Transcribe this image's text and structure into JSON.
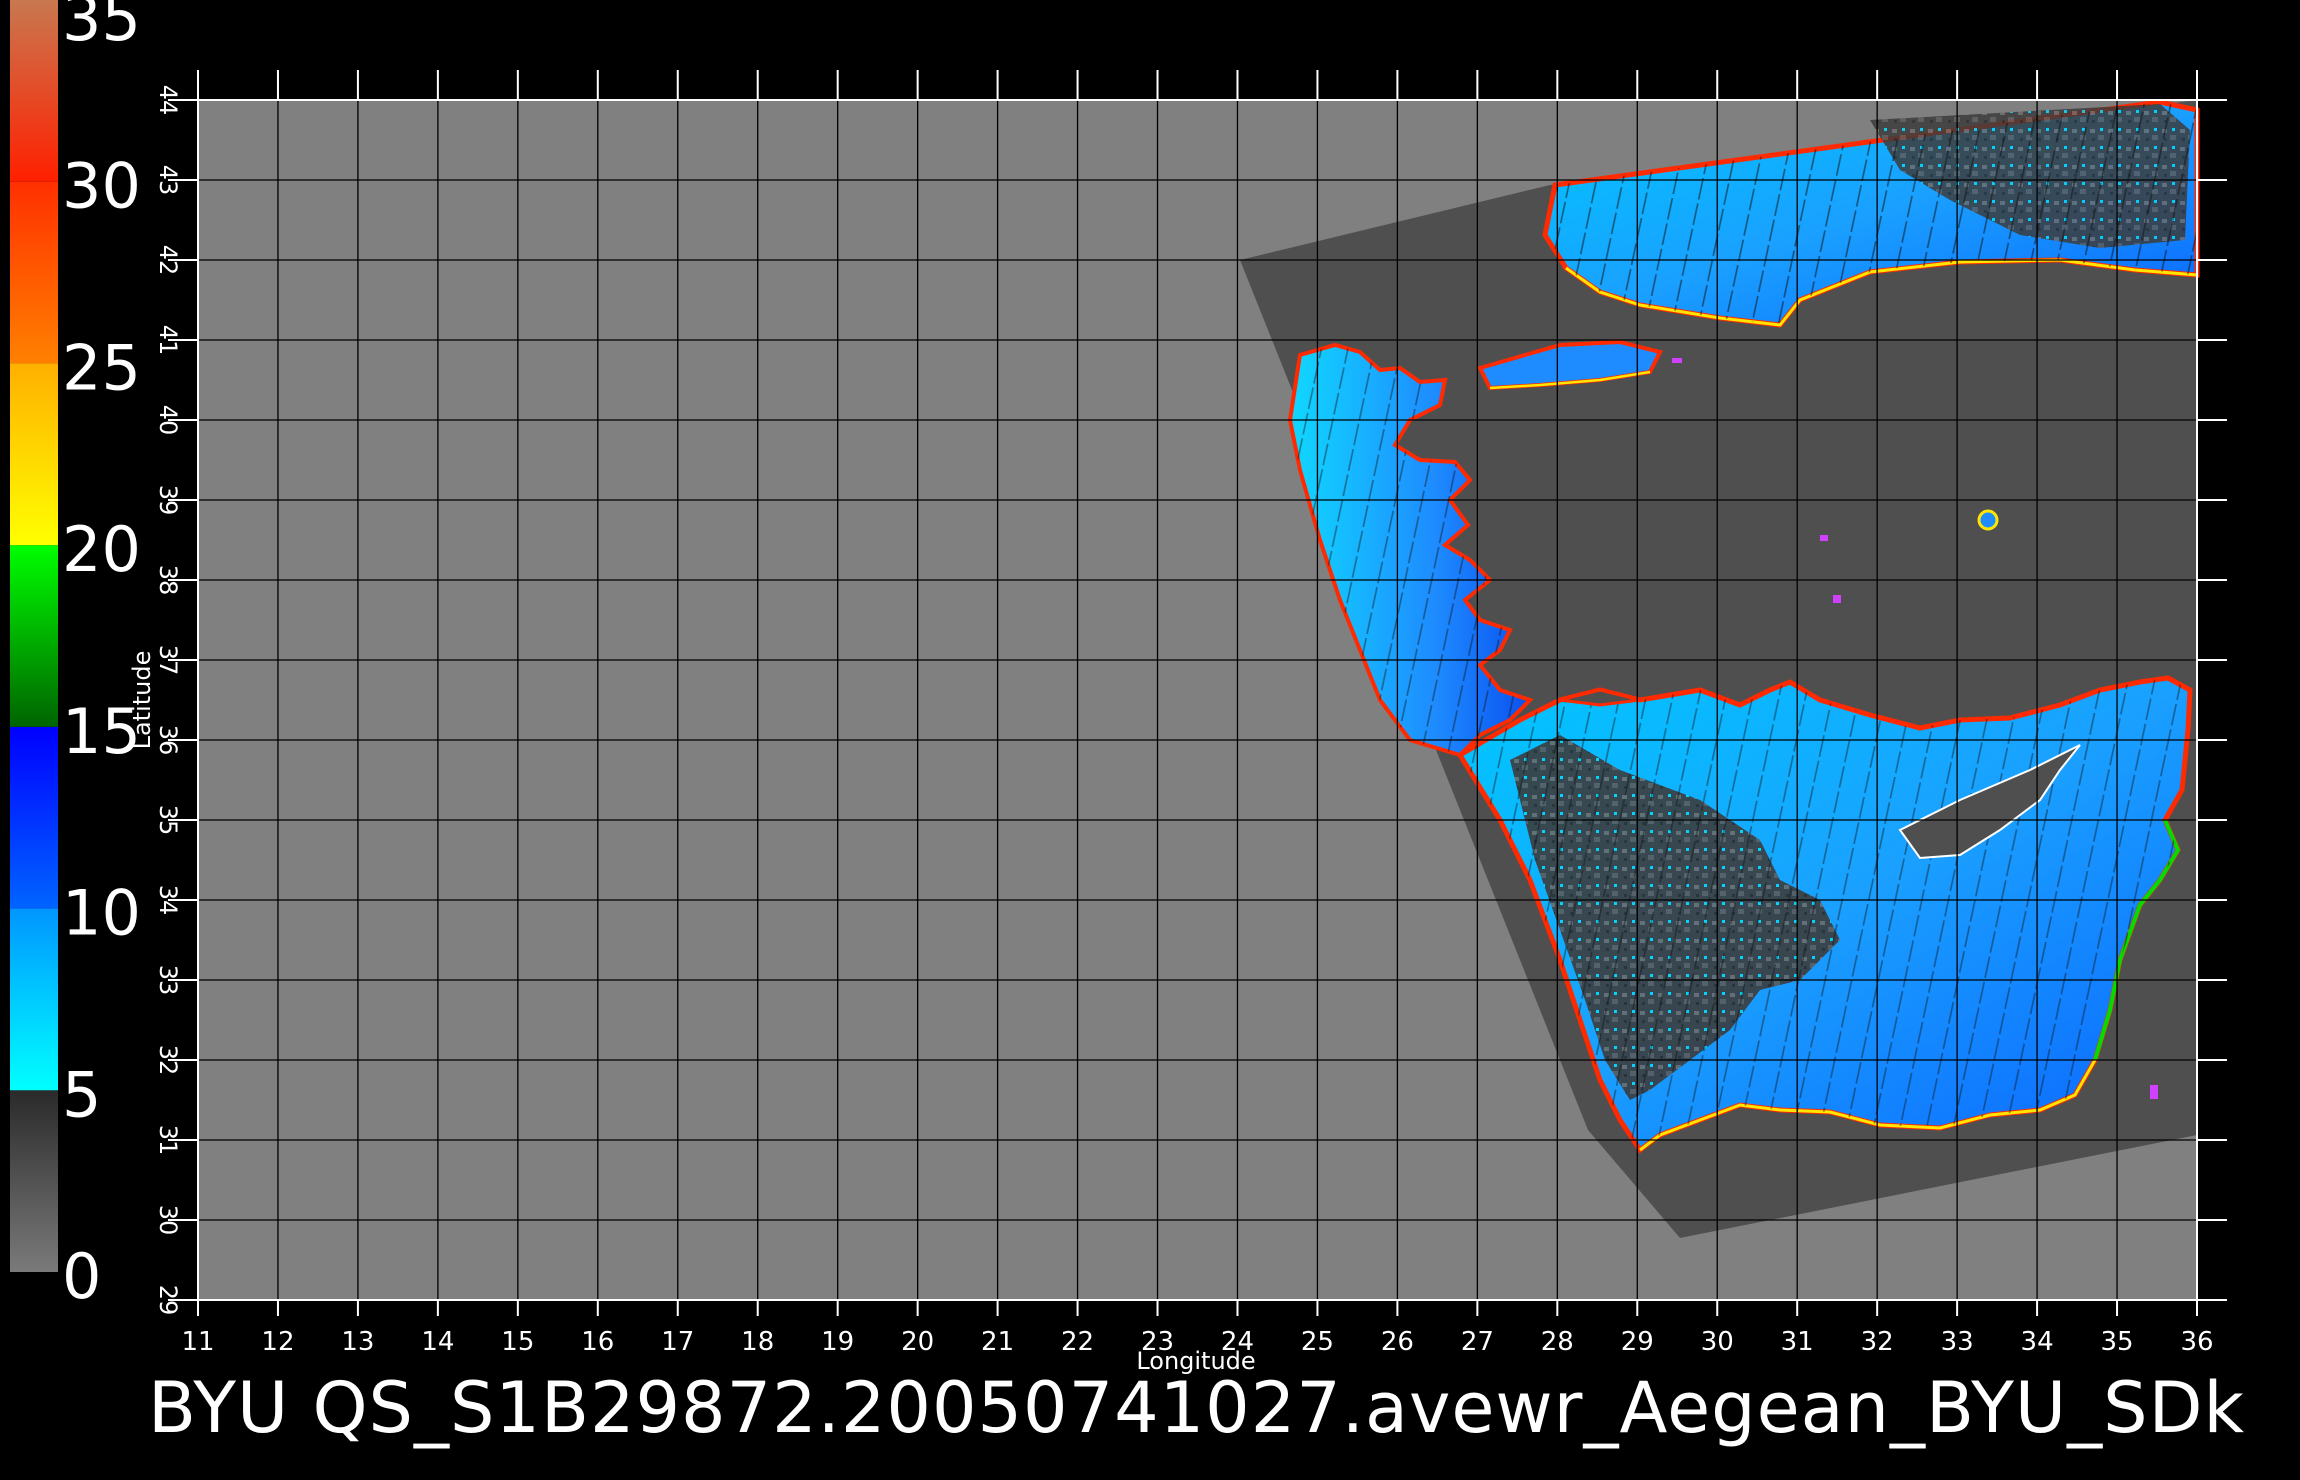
{
  "caption": "BYU  QS_S1B29872.20050741027.avewr_Aegean_BYU_SDk",
  "map": {
    "xlabel": "Longitude",
    "ylabel": "Latitude",
    "lon_range": [
      11,
      36
    ],
    "lat_range": [
      29,
      44
    ],
    "lon_ticks": [
      "11",
      "12",
      "13",
      "14",
      "15",
      "16",
      "17",
      "18",
      "19",
      "20",
      "21",
      "22",
      "23",
      "24",
      "25",
      "26",
      "27",
      "28",
      "29",
      "30",
      "31",
      "32",
      "33",
      "34",
      "35",
      "36"
    ],
    "lat_ticks": [
      "29",
      "30",
      "31",
      "32",
      "33",
      "34",
      "35",
      "36",
      "37",
      "38",
      "39",
      "40",
      "41",
      "42",
      "43",
      "44"
    ],
    "background_color": "#808080",
    "swath_color": "#4f4f4f",
    "grid": true
  },
  "colorbar": {
    "ticks": [
      "0",
      "5",
      "10",
      "15",
      "20",
      "25",
      "30",
      "35"
    ],
    "range": [
      0,
      35
    ],
    "segments": [
      {
        "from": 0,
        "to": 5,
        "colors": [
          "#7a7a7a",
          "#2a2a2a"
        ]
      },
      {
        "from": 5,
        "to": 10,
        "colors": [
          "#00ffff",
          "#0096ff"
        ]
      },
      {
        "from": 10,
        "to": 15,
        "colors": [
          "#0064ff",
          "#0000ff"
        ]
      },
      {
        "from": 15,
        "to": 20,
        "colors": [
          "#006400",
          "#00ff00"
        ]
      },
      {
        "from": 20,
        "to": 25,
        "colors": [
          "#ffff00",
          "#ffb000"
        ]
      },
      {
        "from": 25,
        "to": 30,
        "colors": [
          "#ff8000",
          "#ff3000"
        ]
      },
      {
        "from": 30,
        "to": 35,
        "colors": [
          "#ff2000",
          "#c87850"
        ]
      }
    ]
  }
}
